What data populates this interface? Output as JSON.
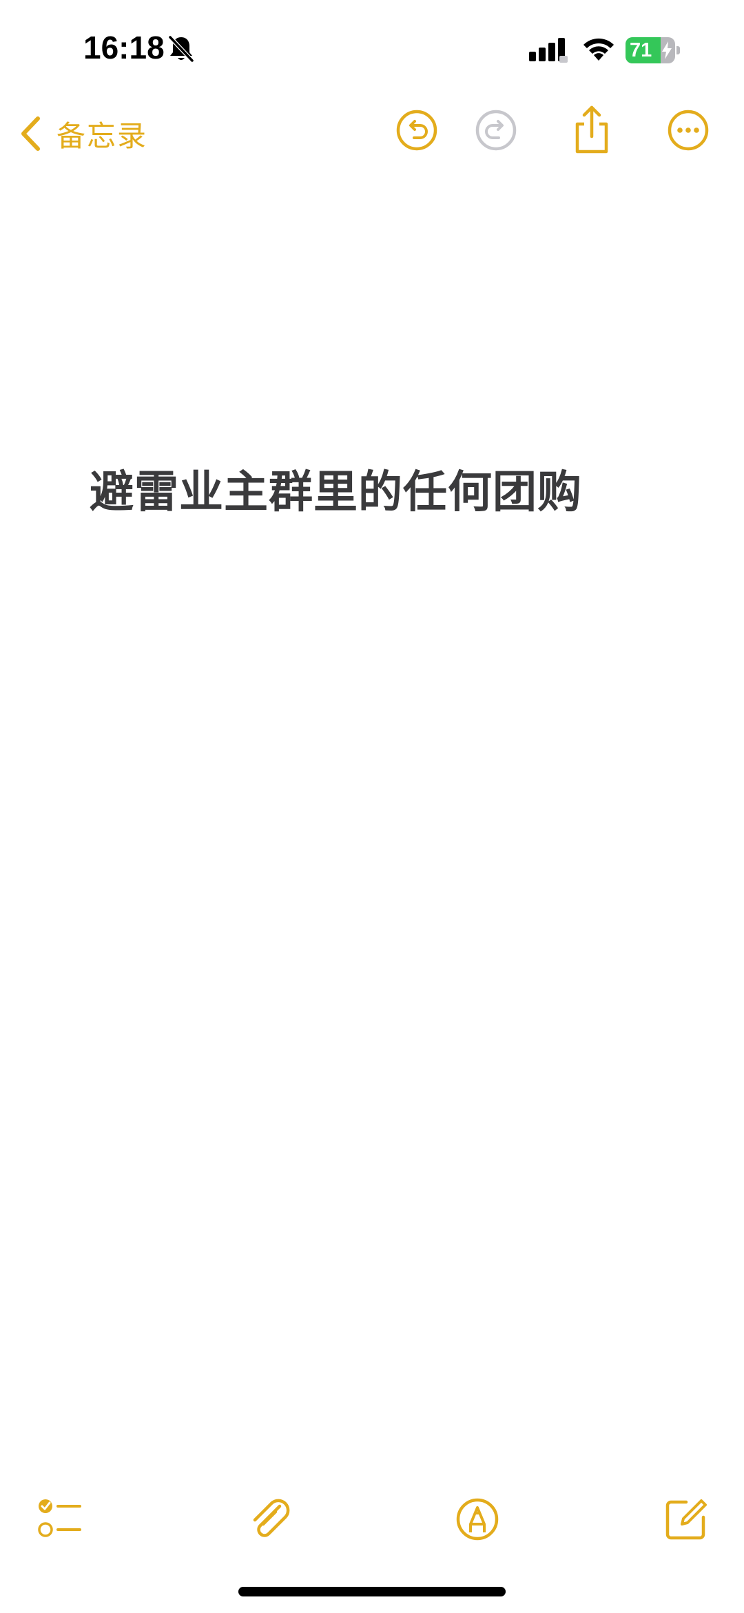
{
  "status_bar": {
    "time": "16:18",
    "battery_level": "71",
    "battery_fraction": 0.71,
    "icons": [
      "bell-muted-icon",
      "signal-icon",
      "wifi-icon",
      "battery-charging-icon"
    ]
  },
  "nav": {
    "back_label": "备忘录",
    "icons": [
      "chevron-left-icon",
      "undo-icon",
      "redo-icon",
      "share-icon",
      "more-icon"
    ]
  },
  "note": {
    "text": "避雷业主群里的任何团购"
  },
  "toolbar": {
    "icons": [
      "checklist-icon",
      "paperclip-icon",
      "markup-pen-icon",
      "compose-icon"
    ]
  },
  "colors": {
    "accent": "#e3ac1c",
    "text": "#3a3a3c",
    "disabled": "#c7c7cc",
    "battery_green": "#34c759",
    "background": "#ffffff"
  }
}
